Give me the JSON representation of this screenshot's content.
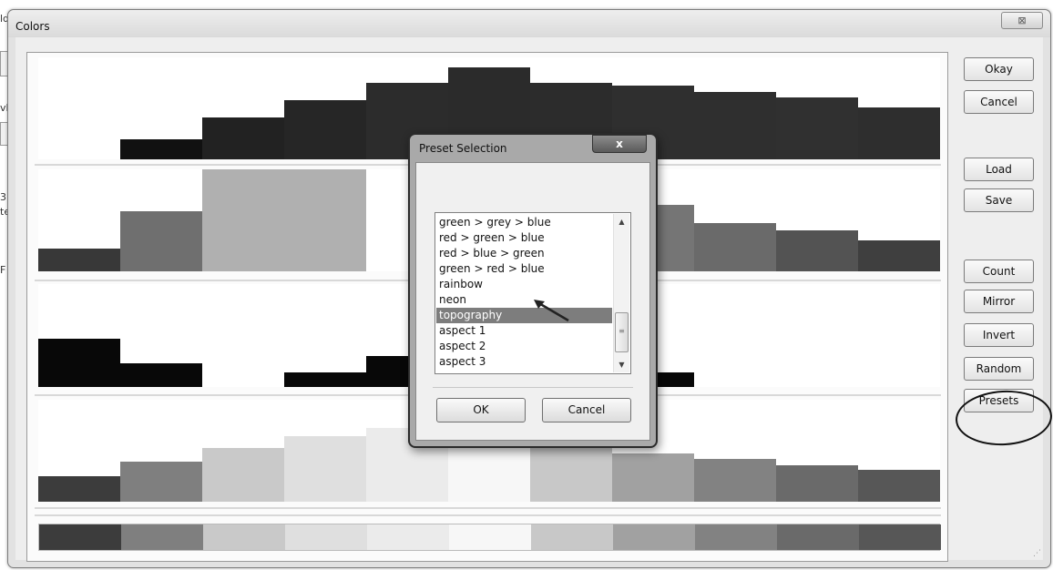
{
  "window": {
    "title": "Colors",
    "close_glyph": "⊠"
  },
  "background_fragments": [
    "ld",
    "vl",
    "3",
    "te",
    "F"
  ],
  "buttons": {
    "okay": "Okay",
    "cancel": "Cancel",
    "load": "Load",
    "save": "Save",
    "count": "Count",
    "mirror": "Mirror",
    "invert": "Invert",
    "random": "Random",
    "presets": "Presets"
  },
  "color_rows": [
    {
      "levels": [
        0,
        0.2,
        0.41,
        0.58,
        0.75,
        0.9,
        0.75,
        0.72,
        0.66,
        0.61,
        0.51
      ],
      "colors": [
        "#ffffff",
        "#111111",
        "#222222",
        "#262626",
        "#2c2c2c",
        "#2b2b2b",
        "#2c2c2c",
        "#2f2f2f",
        "#2f2f2f",
        "#303030",
        "#2e2e2e"
      ]
    },
    {
      "levels": [
        0.22,
        0.59,
        1.0,
        1.0,
        0.0,
        0.0,
        0.0,
        0.65,
        0.47,
        0.4,
        0.3
      ],
      "colors": [
        "#383838",
        "#6f6f6f",
        "#b0b0b0",
        "#b0b0b0",
        "#ffffff",
        "#ffffff",
        "#ffffff",
        "#757575",
        "#6a6a6a",
        "#535353",
        "#3f3f3f"
      ]
    },
    {
      "levels": [
        0.47,
        0.23,
        0,
        0.14,
        0.3,
        0,
        0,
        0.14,
        0,
        0,
        0
      ],
      "colors": [
        "#080808",
        "#080808",
        "#ffffff",
        "#080808",
        "#080808",
        "#ffffff",
        "#ffffff",
        "#080808",
        "#ffffff",
        "#ffffff",
        "#ffffff"
      ]
    },
    {
      "levels": [
        0.25,
        0.39,
        0.53,
        0.64,
        0.72,
        0.62,
        0.53,
        0.47,
        0.42,
        0.36,
        0.31
      ],
      "colors": [
        "#3c3c3c",
        "#7f7f7f",
        "#c9c9c9",
        "#dfdfdf",
        "#ebebeb",
        "#f7f7f7",
        "#c8c8c8",
        "#a1a1a1",
        "#828282",
        "#6a6a6a",
        "#575757"
      ]
    }
  ],
  "swatch_colors": [
    "#3c3c3c",
    "#7f7f7f",
    "#c9c9c9",
    "#dfdfdf",
    "#ebebeb",
    "#f7f7f7",
    "#c8c8c8",
    "#a1a1a1",
    "#828282",
    "#6a6a6a",
    "#575757"
  ],
  "dialog": {
    "title": "Preset Selection",
    "close_glyph": "x",
    "presets": [
      "green > grey > blue",
      "red > green > blue",
      "red > blue > green",
      "green > red > blue",
      "rainbow",
      "neon",
      "topography",
      "aspect 1",
      "aspect 2",
      "aspect 3"
    ],
    "selected_index": 6,
    "ok": "OK",
    "cancel": "Cancel"
  }
}
